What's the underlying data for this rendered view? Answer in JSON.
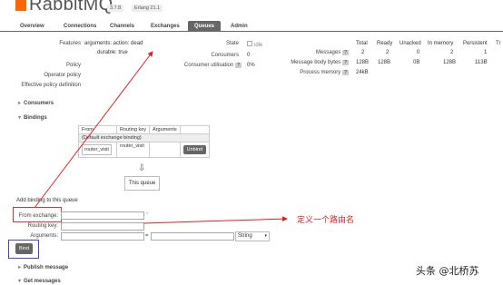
{
  "header": {
    "logo": "RabbitMQ",
    "version": "3.7.8",
    "erlang": "Erlang 21.1"
  },
  "nav": {
    "tabs": [
      "Overview",
      "Connections",
      "Channels",
      "Exchanges",
      "Queues",
      "Admin"
    ],
    "active": "Queues"
  },
  "details": {
    "features_label": "Features",
    "features_args": "arguments: action: dead",
    "features_durable": "durable: true",
    "policy_label": "Policy",
    "operator_policy_label": "Operator policy",
    "effective_policy_label": "Effective policy definition",
    "state_label": "State",
    "state_value": "idle",
    "consumers_label": "Consumers",
    "consumers_value": "0",
    "util_label": "Consumer utilisation",
    "util_value": "0%"
  },
  "stats": {
    "headers": [
      "Total",
      "Ready",
      "Unacked",
      "In memory",
      "Persistent",
      "Tr"
    ],
    "messages_label": "Messages",
    "messages_values": [
      "2",
      "2",
      "0",
      "2",
      "1"
    ],
    "body_label": "Message body bytes",
    "body_values": [
      "128B",
      "128B",
      "0B",
      "128B",
      "113B"
    ],
    "process_label": "Process memory",
    "process_value": "24kB"
  },
  "sections": {
    "consumers": "Consumers",
    "bindings": "Bindings",
    "publish": "Publish message",
    "get": "Get messages"
  },
  "bindings": {
    "headers": [
      "From",
      "Routing key",
      "Arguments"
    ],
    "default_row": "(Default exchange binding)",
    "row_from": "router_visit",
    "row_key": "router_visit",
    "unbind": "Unbind",
    "down_arrow": "⇩",
    "this_queue": "This queue"
  },
  "add_binding": {
    "title": "Add binding to this queue",
    "from_label": "From exchange:",
    "routing_label": "Routing key:",
    "args_label": "Arguments:",
    "eq": "=",
    "type_value": "String",
    "bind_button": "Bind",
    "asterisk": "*"
  },
  "annotation": {
    "text": "定义一个路由名"
  },
  "watermark": {
    "text": "头条 @北桥苏"
  },
  "colors": {
    "accent": "#ff6600",
    "annotation": "#dd2222"
  }
}
